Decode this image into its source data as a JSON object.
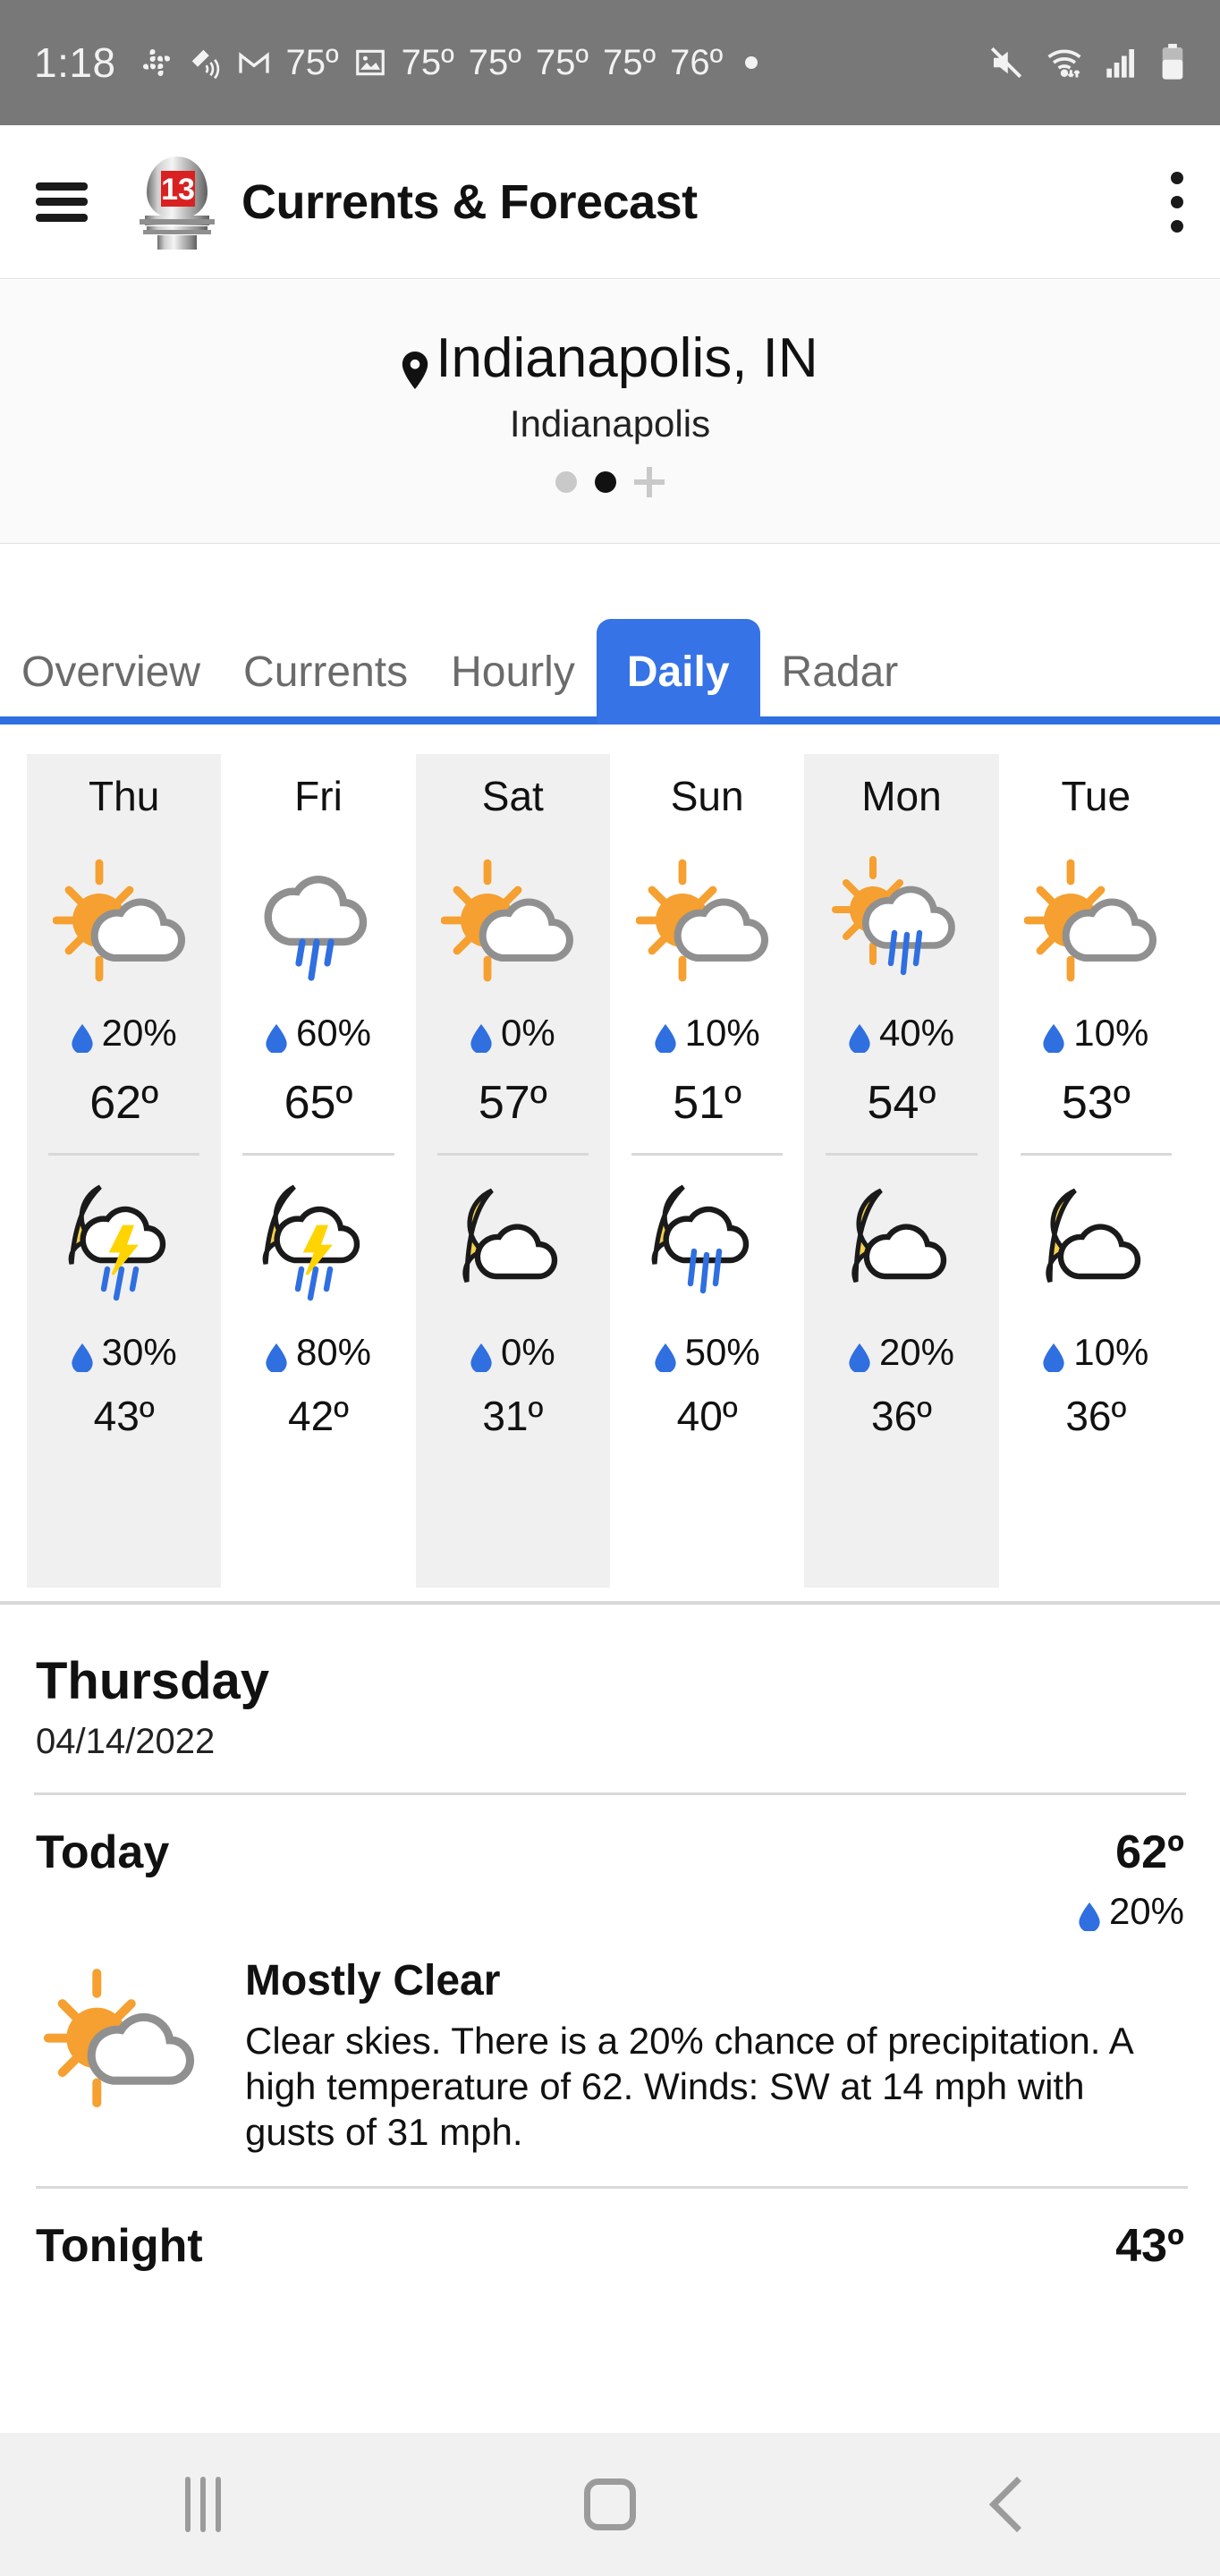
{
  "statusbar": {
    "time": "1:18",
    "icons": [
      "slack-icon",
      "satellite-icon",
      "gmail-icon"
    ],
    "temps": [
      "75º",
      "75º",
      "75º",
      "75º",
      "75º",
      "76º"
    ],
    "photo_icon": "image-icon",
    "dot_icon": "more-dot-icon",
    "right_icons": [
      "mute-icon",
      "wifi-icon",
      "signal-icon",
      "battery-icon"
    ]
  },
  "appbar": {
    "menu_icon": "hamburger-menu-icon",
    "logo_icon": "channel-13-logo-icon",
    "logo_number": "13",
    "title": "Currents & Forecast",
    "overflow_icon": "kebab-menu-icon"
  },
  "location": {
    "pin_icon": "location-pin-icon",
    "city_state": "Indianapolis, IN",
    "city": "Indianapolis",
    "add_icon": "add-location-icon",
    "pages": 2,
    "active_page": 2
  },
  "tabs": [
    {
      "label": "Overview",
      "active": false
    },
    {
      "label": "Currents",
      "active": false
    },
    {
      "label": "Hourly",
      "active": false
    },
    {
      "label": "Daily",
      "active": true
    },
    {
      "label": "Radar",
      "active": false
    }
  ],
  "forecast_days": [
    {
      "day": "Thu",
      "shaded": true,
      "day_icon": "sun-cloud-icon",
      "day_pop": "20%",
      "high": "62º",
      "night_icon": "moon-cloud-thunder-rain-icon",
      "night_pop": "30%",
      "low": "43º"
    },
    {
      "day": "Fri",
      "shaded": false,
      "day_icon": "cloud-rain-icon",
      "day_pop": "60%",
      "high": "65º",
      "night_icon": "moon-cloud-thunder-rain-icon",
      "night_pop": "80%",
      "low": "42º"
    },
    {
      "day": "Sat",
      "shaded": true,
      "day_icon": "sun-cloud-icon",
      "day_pop": "0%",
      "high": "57º",
      "night_icon": "moon-cloud-icon",
      "night_pop": "0%",
      "low": "31º"
    },
    {
      "day": "Sun",
      "shaded": false,
      "day_icon": "sun-cloud-icon",
      "day_pop": "10%",
      "high": "51º",
      "night_icon": "moon-cloud-rain-icon",
      "night_pop": "50%",
      "low": "40º"
    },
    {
      "day": "Mon",
      "shaded": true,
      "day_icon": "sun-cloud-rain-icon",
      "day_pop": "40%",
      "high": "54º",
      "night_icon": "moon-cloud-icon",
      "night_pop": "20%",
      "low": "36º"
    },
    {
      "day": "Tue",
      "shaded": false,
      "day_icon": "sun-cloud-icon",
      "day_pop": "10%",
      "high": "53º",
      "night_icon": "moon-cloud-icon",
      "night_pop": "10%",
      "low": "36º"
    }
  ],
  "detail": {
    "day_name": "Thursday",
    "date": "04/14/2022",
    "periods": [
      {
        "name": "Today",
        "temp": "62º",
        "pop": "20%",
        "icon": "sun-cloud-icon",
        "condition": "Mostly Clear",
        "narrative": "Clear skies. There is a 20% chance of precipitation.  A high temperature of 62.  Winds: SW at 14 mph with gusts of 31 mph."
      },
      {
        "name": "Tonight",
        "temp": "43º"
      }
    ]
  },
  "navbar": {
    "recents_icon": "recents-icon",
    "home_icon": "home-icon",
    "back_icon": "back-icon"
  },
  "colors": {
    "accent": "#3573e6",
    "statusbar_bg": "#787878",
    "sun": "#f5a030",
    "moon": "#f5d14e",
    "cloud_day": "#909090",
    "cloud_night": "#1a1a1a",
    "rain": "#2f6fe0",
    "drop": "#2f6fe0",
    "lightning": "#ffd400"
  }
}
